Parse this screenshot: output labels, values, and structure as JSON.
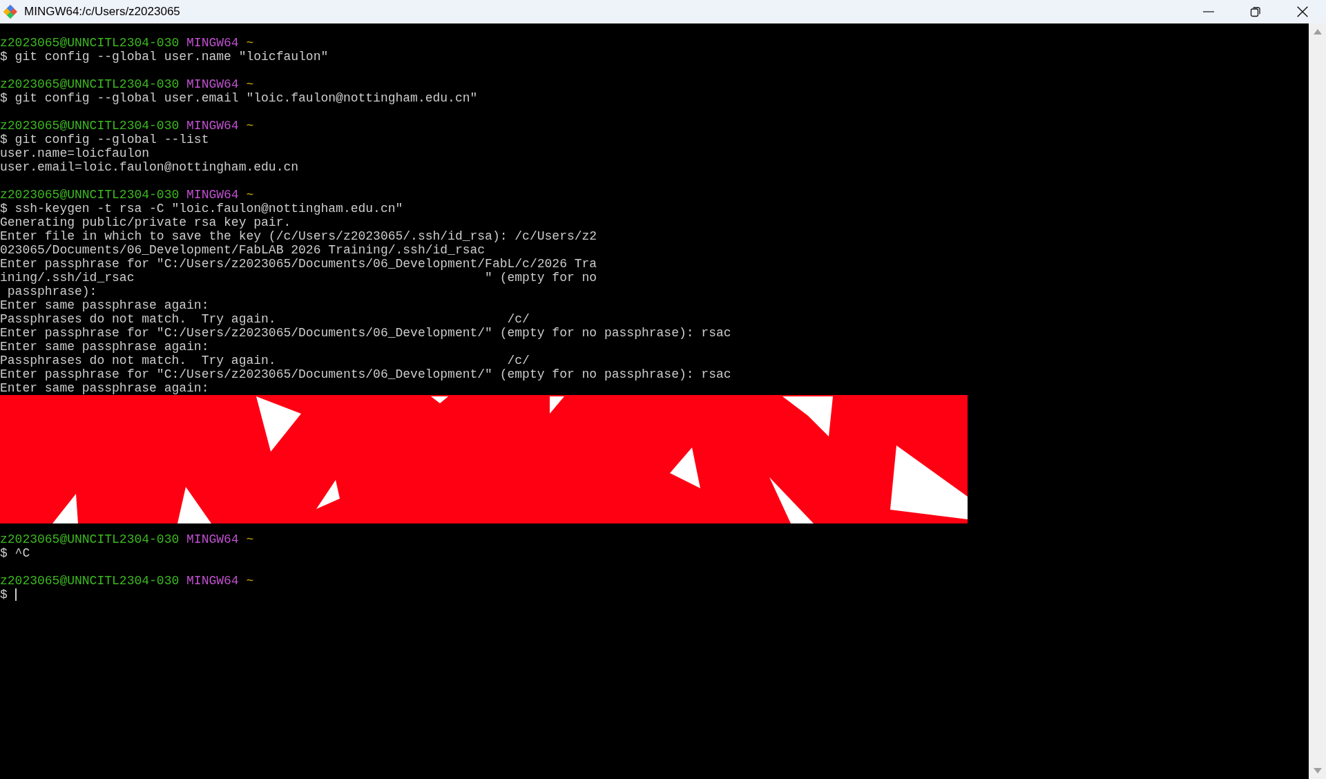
{
  "window": {
    "title": "MINGW64:/c/Users/z2023065"
  },
  "terminal": {
    "lines": [
      {
        "kind": "prompt",
        "user": "z2023065@UNNCITL2304-030",
        "shell": "MINGW64",
        "path": "~"
      },
      {
        "kind": "text",
        "text": "$ git config --global user.name \"loicfaulon\""
      },
      {
        "kind": "blank"
      },
      {
        "kind": "prompt",
        "user": "z2023065@UNNCITL2304-030",
        "shell": "MINGW64",
        "path": "~"
      },
      {
        "kind": "text",
        "text": "$ git config --global user.email \"loic.faulon@nottingham.edu.cn\""
      },
      {
        "kind": "blank"
      },
      {
        "kind": "prompt",
        "user": "z2023065@UNNCITL2304-030",
        "shell": "MINGW64",
        "path": "~"
      },
      {
        "kind": "text",
        "text": "$ git config --global --list"
      },
      {
        "kind": "text",
        "text": "user.name=loicfaulon"
      },
      {
        "kind": "text",
        "text": "user.email=loic.faulon@nottingham.edu.cn"
      },
      {
        "kind": "blank"
      },
      {
        "kind": "prompt",
        "user": "z2023065@UNNCITL2304-030",
        "shell": "MINGW64",
        "path": "~"
      },
      {
        "kind": "text",
        "text": "$ ssh-keygen -t rsa -C \"loic.faulon@nottingham.edu.cn\""
      },
      {
        "kind": "text",
        "text": "Generating public/private rsa key pair."
      },
      {
        "kind": "text",
        "text": "Enter file in which to save the key (/c/Users/z2023065/.ssh/id_rsa): /c/Users/z2"
      },
      {
        "kind": "text",
        "text": "023065/Documents/06_Development/FabLAB 2026 Training/.ssh/id_rsac"
      },
      {
        "kind": "text",
        "text": "Enter passphrase for \"C:/Users/z2023065/Documents/06_Development/FabL/c/2026 Tra"
      },
      {
        "kind": "text",
        "text": "ining/.ssh/id_rsac                                               \" (empty for no"
      },
      {
        "kind": "text",
        "text": " passphrase):"
      },
      {
        "kind": "text",
        "text": "Enter same passphrase again:"
      },
      {
        "kind": "text",
        "text": "Passphrases do not match.  Try again.                               /c/"
      },
      {
        "kind": "text",
        "text": "Enter passphrase for \"C:/Users/z2023065/Documents/06_Development/\" (empty for no passphrase): rsac"
      },
      {
        "kind": "text",
        "text": "Enter same passphrase again:"
      },
      {
        "kind": "text",
        "text": "Passphrases do not match.  Try again.                               /c/"
      },
      {
        "kind": "text",
        "text": "Enter passphrase for \"C:/Users/z2023065/Documents/06_Development/\" (empty for no passphrase): rsac"
      },
      {
        "kind": "text",
        "text": "Enter same passphrase again:"
      },
      {
        "kind": "image"
      },
      {
        "kind": "prompt",
        "user": "z2023065@UNNCITL2304-030",
        "shell": "MINGW64",
        "path": "~"
      },
      {
        "kind": "text",
        "text": "$ ^C"
      },
      {
        "kind": "blank"
      },
      {
        "kind": "prompt",
        "user": "z2023065@UNNCITL2304-030",
        "shell": "MINGW64",
        "path": "~"
      },
      {
        "kind": "input",
        "text": "$ ",
        "cursor": true
      }
    ]
  }
}
